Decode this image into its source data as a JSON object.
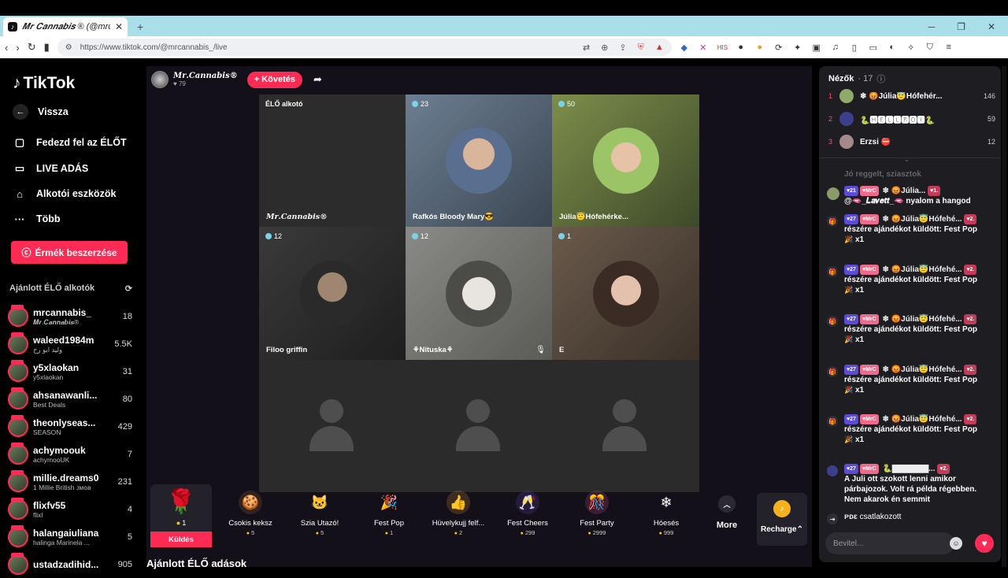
{
  "browser": {
    "tab_title": "𝑴𝒓 𝑪𝒂𝒏𝒏𝒂𝒃𝒊𝒔 ® (@mrcan",
    "new_tab": "+",
    "url": "https://www.tiktok.com/@mrcannabis_/live"
  },
  "sidebar": {
    "logo": "TikTok",
    "back": "Vissza",
    "explore_live": "Fedezd fel az ÉLŐT",
    "live_studio": "LIVE ADÁS",
    "creator_tools": "Alkotói eszközök",
    "more": "Több",
    "coins_button": "Érmék beszerzése",
    "recommended_header": "Ajánlott ÉLŐ alkotók",
    "recommended": [
      {
        "name": "mrcannabis_",
        "sub": "𝑴𝒓.𝑪𝒂𝒏𝒏𝒂𝒃𝒊𝒔®",
        "count": "18"
      },
      {
        "name": "waleed1984m",
        "sub": "وليد ابو رح",
        "count": "5.5K"
      },
      {
        "name": "y5xlaokan",
        "sub": "y5xlaokan",
        "count": "31"
      },
      {
        "name": "ahsanawanli...",
        "sub": "Best Deals",
        "count": "80"
      },
      {
        "name": "theonlyseas...",
        "sub": "SEASON",
        "count": "429"
      },
      {
        "name": "achymoouk",
        "sub": "achymooUK",
        "count": "7"
      },
      {
        "name": "millie.dreams0",
        "sub": "1 Millie British ᴊᴍɢʙ",
        "count": "231"
      },
      {
        "name": "flixfv55",
        "sub": "flixl",
        "count": "4"
      },
      {
        "name": "halangaiuliana",
        "sub": "halinga Marinela ...",
        "count": "5"
      },
      {
        "name": "ustadzadihid...",
        "sub": "",
        "count": "905"
      }
    ]
  },
  "stream": {
    "host_name": "𝑴𝒓.𝑪𝒂𝒏𝒏𝒂𝒃𝒊𝒔®",
    "host_likes": "♥ 79",
    "follow": "+ Követés",
    "recommended_live": "Ajánlott ÉLŐ adások",
    "cells": [
      {
        "label": "𝑴𝒓.𝑪𝒂𝒏𝒏𝒂𝒃𝒊𝒔®",
        "top": "ÉLŐ alkotó",
        "viewers": ""
      },
      {
        "label": "Rafkós Bloody Mary😎",
        "top": "",
        "viewers": "23"
      },
      {
        "label": "Júlia😇Hófehérke...",
        "top": "",
        "viewers": "50"
      },
      {
        "label": "Filoo griffin",
        "top": "",
        "viewers": "12"
      },
      {
        "label": "⚘Nituska⚘",
        "top": "",
        "viewers": "12"
      },
      {
        "label": "E",
        "top": "",
        "viewers": "1"
      }
    ]
  },
  "gifts": {
    "send": {
      "name": "Küldés",
      "price": "1"
    },
    "items": [
      {
        "name": "Csokis keksz",
        "price": "5",
        "icon": "🍪"
      },
      {
        "name": "Szia Utazó!",
        "price": "5",
        "icon": "🐱"
      },
      {
        "name": "Fest Pop",
        "price": "1",
        "icon": "🎉"
      },
      {
        "name": "Hüvelykujj felf...",
        "price": "2",
        "icon": "👍"
      },
      {
        "name": "Fest Cheers",
        "price": "299",
        "icon": "🥂"
      },
      {
        "name": "Fest Party",
        "price": "2999",
        "icon": "🎊"
      },
      {
        "name": "Hóesés",
        "price": "999",
        "icon": "❄"
      }
    ],
    "more": "More",
    "recharge": "Recharge"
  },
  "chat": {
    "viewers_title": "Nézők",
    "viewers_count": "· 17",
    "top_viewers": [
      {
        "rank": "1",
        "name": "❄ 😡Júlia😇Hófehér...",
        "score": "146"
      },
      {
        "rank": "2",
        "name": "🐍🅷🅴🅻🅻🅱🅾🆈🐍",
        "score": "59"
      },
      {
        "rank": "3",
        "name": "Erzsi ⛔",
        "score": "12"
      }
    ],
    "faded": "Jó reggelt, sziasztok",
    "messages": [
      {
        "lvl": "21",
        "user": "❄ 😡Júlia...",
        "sub": "1.",
        "text": "@🫦_𝑳𝒂𝒗𝒆𝒕𝒕_🫦 nyalom a hangod"
      },
      {
        "lvl": "27",
        "user": "❄ 😡Júlia😇Hófehé...",
        "sub": "2.",
        "text": "részére ajándékot küldött: Fest Pop",
        "qty": "x1"
      },
      {
        "lvl": "27",
        "user": "❄ 😡Júlia😇Hófehé...",
        "sub": "2.",
        "text": "részére ajándékot küldött: Fest Pop",
        "qty": "x1"
      },
      {
        "lvl": "27",
        "user": "❄ 😡Júlia😇Hófehé...",
        "sub": "2.",
        "text": "részére ajándékot küldött: Fest Pop",
        "qty": "x1"
      },
      {
        "lvl": "27",
        "user": "❄ 😡Júlia😇Hófehé...",
        "sub": "2.",
        "text": "részére ajándékot küldött: Fest Pop",
        "qty": "x1"
      },
      {
        "lvl": "27",
        "user": "❄ 😡Júlia😇Hófehé...",
        "sub": "2.",
        "text": "részére ajándékot küldött: Fest Pop",
        "qty": "x1"
      },
      {
        "lvl": "27",
        "user": "🐍▇▇▇▇▇▇...",
        "sub": "2.",
        "text": "A Juli ott szokott lenni amikor párbajozok. Volt rá példa régebben. Nem akarok én semmit"
      }
    ],
    "joined_user": "ᴘᴅɛ",
    "joined_text": "csatlakozott",
    "input_placeholder": "Bevitel..."
  }
}
